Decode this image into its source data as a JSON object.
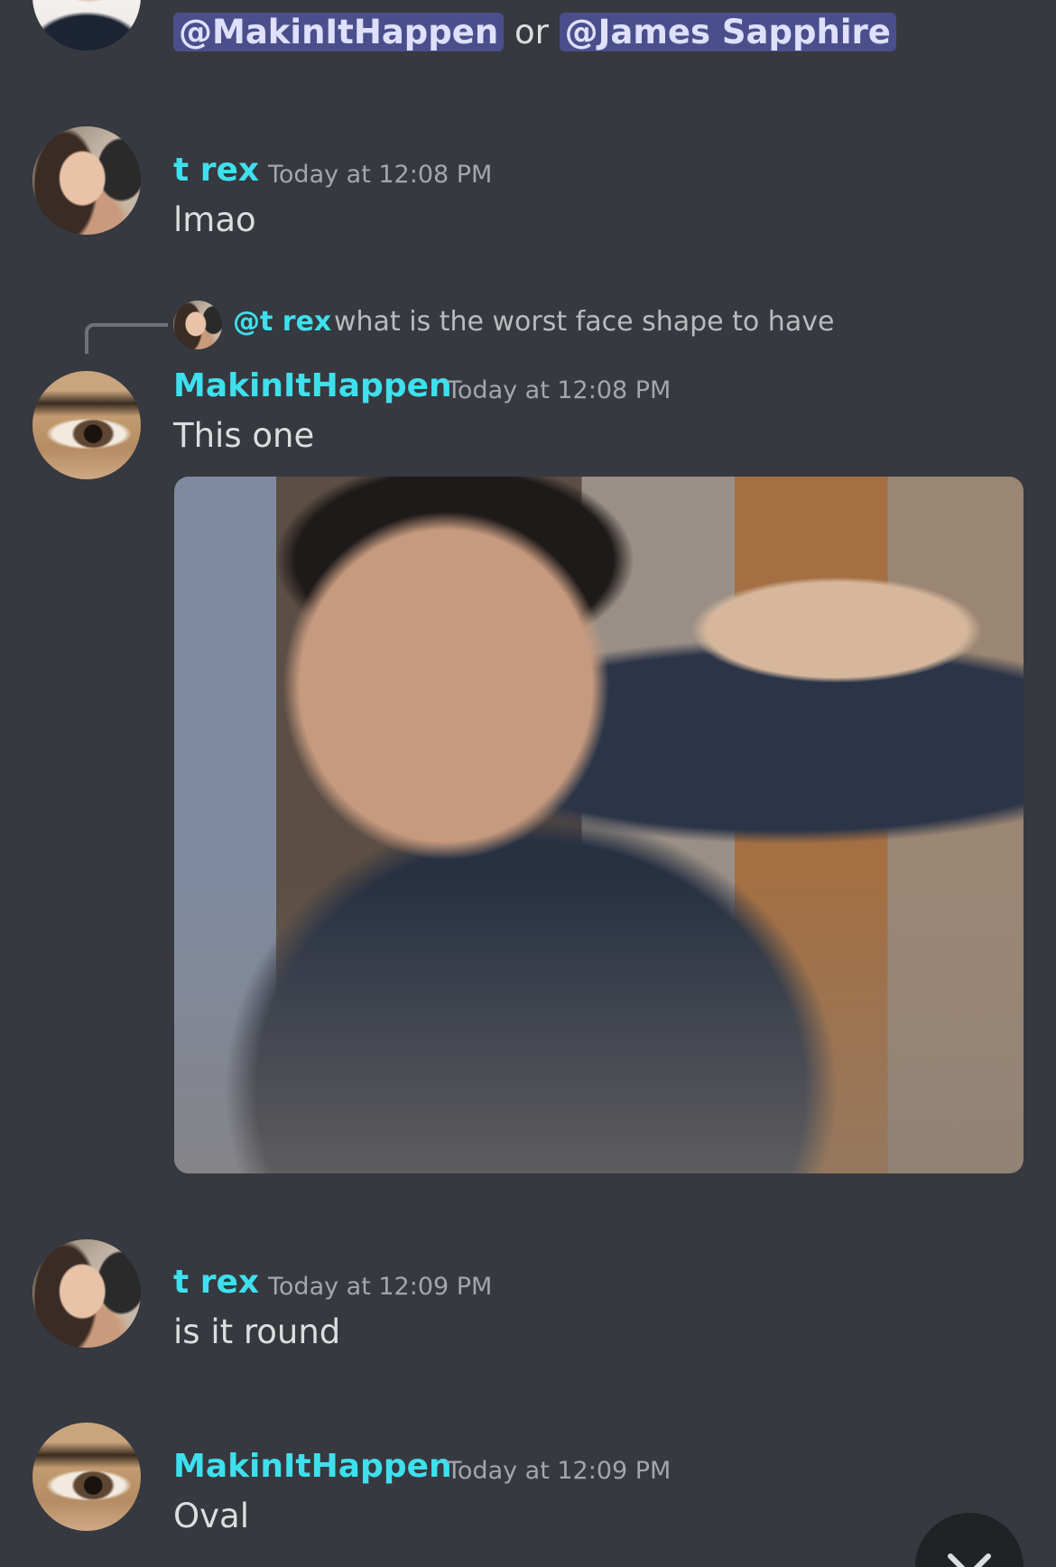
{
  "messages": [
    {
      "mentions": [
        "@MakinItHappen",
        "@James Sapphire"
      ],
      "connector": "or"
    },
    {
      "username": "t rex",
      "timestamp": "Today at 12:08 PM",
      "text": "lmao"
    },
    {
      "reply": {
        "mention": "@t rex",
        "text": "what is the worst face shape to have"
      },
      "username": "MakinItHappen",
      "timestamp": "Today at 12:08 PM",
      "text": "This one",
      "attachment": "image"
    },
    {
      "username": "t rex",
      "timestamp": "Today at 12:09 PM",
      "text": "is it round"
    },
    {
      "username": "MakinItHappen",
      "timestamp": "Today at 12:09 PM",
      "text": "Oval"
    }
  ],
  "scroll_button_icon": "chevron-down-icon",
  "colors": {
    "background": "#36393f",
    "username": "#3ee0ee",
    "mention_bg": "#4a4f8c",
    "timestamp": "#a3a6aa"
  }
}
